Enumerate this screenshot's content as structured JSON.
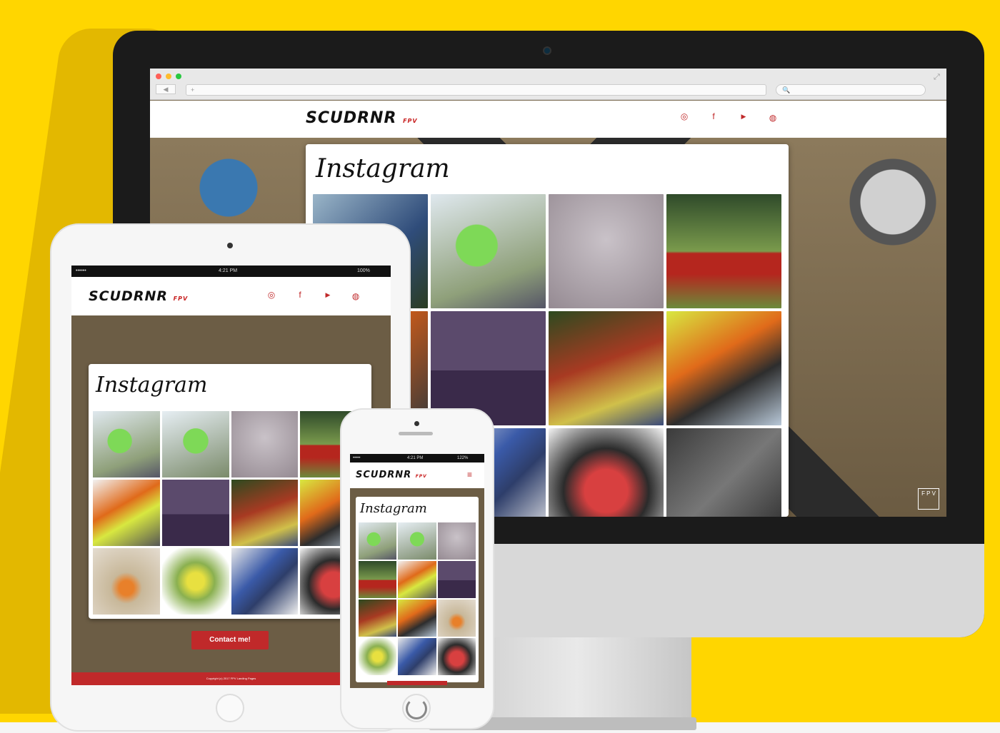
{
  "brand": {
    "logo": "SCUDRNR",
    "logo_sub": "FPV",
    "accent": "#c0292a"
  },
  "desktop": {
    "browser": {
      "back": "◀",
      "forward": "▶",
      "url_icon": "+",
      "search_icon": "🔍",
      "expand_icon": "⤢"
    },
    "social": [
      {
        "icon": "instagram-icon",
        "glyph": "◎"
      },
      {
        "icon": "facebook-icon",
        "glyph": "f"
      },
      {
        "icon": "youtube-icon",
        "glyph": "▶"
      },
      {
        "icon": "dribbble-icon",
        "glyph": "◍"
      }
    ],
    "section_title": "Instagram",
    "watermark": "F P V",
    "photos": [
      "drone-prop-sky",
      "green-prop-street",
      "sky-fisheye",
      "red-drone-park",
      "green-prop-frame",
      "rf-betafl-sticker",
      "drone-picnic-table",
      "orange-camera-mount",
      "yellow-props-sky",
      "blue-frame-white",
      "red-board-frame",
      "carbon-frame-arms"
    ]
  },
  "tablet": {
    "status": {
      "left": "•••••• ",
      "time": "4:21 PM",
      "right": "100%"
    },
    "section_title": "Instagram",
    "contact_button": "Contact me!",
    "footer": "Copyright (c) 2017 FPV Landing Pages"
  },
  "phone": {
    "status": {
      "left": "•••••",
      "time": "4:21 PM",
      "right": "122%"
    },
    "section_title": "Instagram",
    "menu_icon": "≡"
  }
}
